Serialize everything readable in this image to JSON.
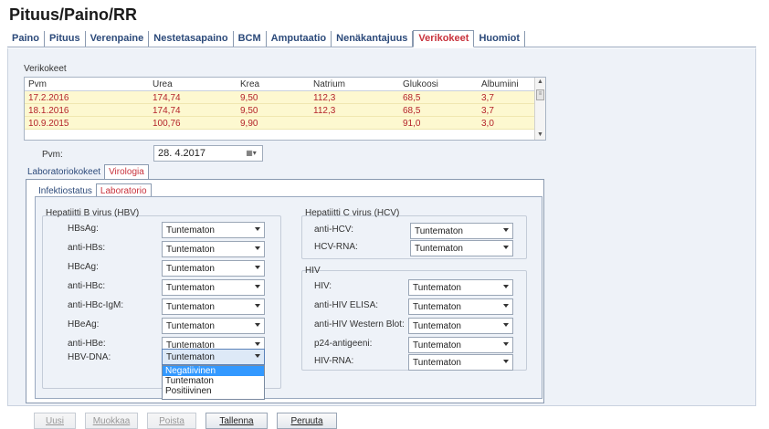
{
  "title": "Pituus/Paino/RR",
  "tabs": [
    {
      "label": "Paino",
      "active": false
    },
    {
      "label": "Pituus",
      "active": false
    },
    {
      "label": "Verenpaine",
      "active": false
    },
    {
      "label": "Nestetasapaino",
      "active": false
    },
    {
      "label": "BCM",
      "active": false
    },
    {
      "label": "Amputaatio",
      "active": false
    },
    {
      "label": "Nenäkantajuus",
      "active": false
    },
    {
      "label": "Verikokeet",
      "active": true
    },
    {
      "label": "Huomiot",
      "active": false
    }
  ],
  "verikokeet": {
    "label": "Verikokeet",
    "columns": [
      "Pvm",
      "Urea",
      "Krea",
      "Natrium",
      "Glukoosi",
      "Albumiini"
    ],
    "rows": [
      [
        "17.2.2016",
        "174,74",
        "9,50",
        "112,3",
        "68,5",
        "3,7"
      ],
      [
        "18.1.2016",
        "174,74",
        "9,50",
        "112,3",
        "68,5",
        "3,7"
      ],
      [
        "10.9.2015",
        "100,76",
        "9,90",
        "",
        "91,0",
        "3,0"
      ]
    ]
  },
  "pvm": {
    "label": "Pvm:",
    "value": "28. 4.2017"
  },
  "subtabs1": [
    {
      "label": "Laboratoriokokeet",
      "active": false
    },
    {
      "label": "Virologia",
      "active": true
    }
  ],
  "subtabs2": [
    {
      "label": "Infektiostatus",
      "active": false
    },
    {
      "label": "Laboratorio",
      "active": true
    }
  ],
  "hbv": {
    "title": "Hepatiitti B virus (HBV)",
    "fields": [
      {
        "label": "HBsAg:",
        "value": "Tuntematon"
      },
      {
        "label": "anti-HBs:",
        "value": "Tuntematon"
      },
      {
        "label": "HBcAg:",
        "value": "Tuntematon"
      },
      {
        "label": "anti-HBc:",
        "value": "Tuntematon"
      },
      {
        "label": "anti-HBc-IgM:",
        "value": "Tuntematon"
      },
      {
        "label": "HBeAg:",
        "value": "Tuntematon"
      },
      {
        "label": "anti-HBe:",
        "value": "Tuntematon"
      },
      {
        "label": "HBV-DNA:",
        "value": "Tuntematon"
      }
    ]
  },
  "hcv": {
    "title": "Hepatiitti C virus (HCV)",
    "fields": [
      {
        "label": "anti-HCV:",
        "value": "Tuntematon"
      },
      {
        "label": "HCV-RNA:",
        "value": "Tuntematon"
      }
    ]
  },
  "hiv": {
    "title": "HIV",
    "fields": [
      {
        "label": "HIV:",
        "value": "Tuntematon"
      },
      {
        "label": "anti-HIV ELISA:",
        "value": "Tuntematon"
      },
      {
        "label": "anti-HIV Western Blot:",
        "value": "Tuntematon"
      },
      {
        "label": "p24-antigeeni:",
        "value": "Tuntematon"
      },
      {
        "label": "HIV-RNA:",
        "value": "Tuntematon"
      }
    ]
  },
  "dropdown_options": [
    "Negatiivinen",
    "Tuntematon",
    "Positiivinen"
  ],
  "dropdown_selected": "Negatiivinen",
  "buttons": {
    "uusi": {
      "label": "Uusi",
      "enabled": false
    },
    "muokkaa": {
      "label": "Muokkaa",
      "enabled": false
    },
    "poista": {
      "label": "Poista",
      "enabled": false
    },
    "tallenna": {
      "label": "Tallenna",
      "enabled": true
    },
    "peruuta": {
      "label": "Peruuta",
      "enabled": true
    }
  }
}
